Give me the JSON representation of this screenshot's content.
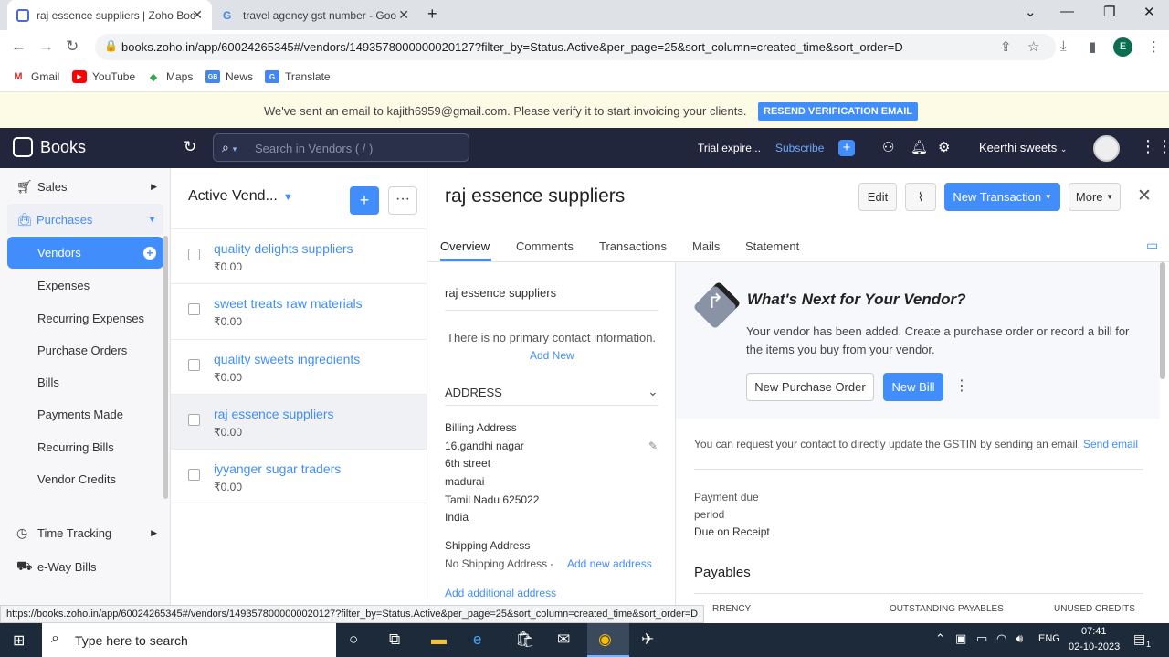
{
  "browser": {
    "tabs": [
      {
        "title": "raj essence suppliers | Zoho Boo",
        "active": true
      },
      {
        "title": "travel agency gst number - Goo",
        "active": false
      }
    ],
    "url": "books.zoho.in/app/60024265345#/vendors/1493578000000020127?filter_by=Status.Active&per_page=25&sort_column=created_time&sort_order=D",
    "profile_initial": "E",
    "bookmarks": [
      "Gmail",
      "YouTube",
      "Maps",
      "News",
      "Translate"
    ]
  },
  "banner": {
    "message": "We've sent an email to kajith6959@gmail.com. Please verify it to start invoicing your clients.",
    "button": "RESEND VERIFICATION EMAIL"
  },
  "header": {
    "app_name": "Books",
    "search_placeholder": "Search in Vendors ( / )",
    "trial": "Trial expire...",
    "subscribe": "Subscribe",
    "org": "Keerthi sweets"
  },
  "sidebar": {
    "items": [
      {
        "label": "Sales"
      },
      {
        "label": "Purchases"
      },
      {
        "label": "Vendors"
      },
      {
        "label": "Expenses"
      },
      {
        "label": "Recurring Expenses"
      },
      {
        "label": "Purchase Orders"
      },
      {
        "label": "Bills"
      },
      {
        "label": "Payments Made"
      },
      {
        "label": "Recurring Bills"
      },
      {
        "label": "Vendor Credits"
      },
      {
        "label": "Time Tracking"
      },
      {
        "label": "e-Way Bills"
      }
    ]
  },
  "vendor_list": {
    "header": "Active Vend...",
    "rows": [
      {
        "name": "quality delights suppliers",
        "amount": "₹0.00"
      },
      {
        "name": "sweet treats raw materials",
        "amount": "₹0.00"
      },
      {
        "name": "quality sweets ingredients",
        "amount": "₹0.00"
      },
      {
        "name": "raj essence suppliers",
        "amount": "₹0.00"
      },
      {
        "name": "iyyanger sugar traders",
        "amount": "₹0.00"
      }
    ]
  },
  "detail": {
    "title": "raj essence suppliers",
    "edit": "Edit",
    "new_transaction": "New Transaction",
    "more": "More",
    "tabs": [
      "Overview",
      "Comments",
      "Transactions",
      "Mails",
      "Statement"
    ],
    "vendor_name": "raj essence suppliers",
    "no_contact": "There is no primary contact information.",
    "add_new": "Add New",
    "address_header": "ADDRESS",
    "billing_label": "Billing Address",
    "billing_lines": [
      "16,gandhi nagar",
      "6th street",
      "madurai",
      "Tamil Nadu 625022",
      "India"
    ],
    "shipping_label": "Shipping Address",
    "no_shipping": "No Shipping Address -",
    "add_new_address": "Add new address",
    "add_additional": "Add additional address",
    "next_title": "What's Next for Your Vendor?",
    "next_text": "Your vendor has been added. Create a purchase order or record a bill for the items you buy from your vendor.",
    "new_po": "New Purchase Order",
    "new_bill": "New Bill",
    "gstin_text": "You can request your contact to directly update the GSTIN by sending an email.",
    "send_email": "Send email",
    "payment_due_label1": "Payment due",
    "payment_due_label2": "period",
    "payment_due_value": "Due on Receipt",
    "payables": "Payables",
    "col_currency": "RRENCY",
    "col_outstanding": "OUTSTANDING PAYABLES",
    "col_unused": "UNUSED CREDITS"
  },
  "status_url": "https://books.zoho.in/app/60024265345#/vendors/1493578000000020127?filter_by=Status.Active&per_page=25&sort_column=created_time&sort_order=D",
  "taskbar": {
    "search": "Type here to search",
    "lang": "ENG",
    "time": "07:41",
    "date": "02-10-2023",
    "notif_count": "1"
  }
}
